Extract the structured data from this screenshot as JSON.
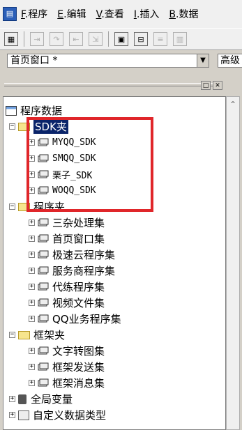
{
  "menubar": {
    "items": [
      {
        "key": "F",
        "label": ".程序"
      },
      {
        "key": "E",
        "label": ".编辑"
      },
      {
        "key": "V",
        "label": ".查看"
      },
      {
        "key": "I",
        "label": ".插入"
      },
      {
        "key": "B",
        "label": ".数据"
      }
    ]
  },
  "toolbar": {
    "buttons": [
      "grid-icon",
      "step-into-icon",
      "step-over-icon",
      "step-out-icon",
      "run-to-icon",
      "window-icon",
      "center-icon",
      "align-icon",
      "table-icon"
    ]
  },
  "combo": {
    "value": "首页窗口 *",
    "second_value": "高级"
  },
  "tree": {
    "root": "程序数据",
    "sdk_folder": "SDK夹",
    "sdk_items": [
      "MYQQ_SDK",
      "SMQQ_SDK",
      "栗子_SDK",
      "WOQQ_SDK"
    ],
    "program_folder": "程序夹",
    "program_items": [
      "三杂处理集",
      "首页窗口集",
      "极速云程序集",
      "服务商程序集",
      "代练程序集",
      "视频文件集",
      "QQ业务程序集"
    ],
    "frame_folder": "框架夹",
    "frame_items": [
      "文字转图集",
      "框架发送集",
      "框架消息集"
    ],
    "global_vars": "全局变量",
    "custom_types": "自定义数据类型"
  },
  "colors": {
    "selection": "#0a246a",
    "highlight_box": "#e0262a",
    "folder": "#f6e58d"
  }
}
